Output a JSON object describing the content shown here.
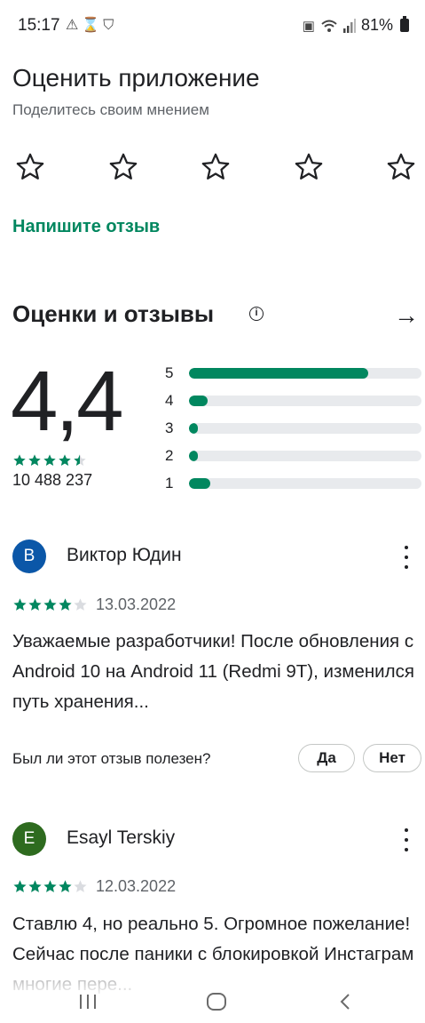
{
  "status_bar": {
    "time": "15:17",
    "battery": "81%",
    "left_icons": [
      "warning-icon",
      "hourglass-icon",
      "shield-icon"
    ],
    "right_icons": [
      "vibrate-icon",
      "wifi-icon",
      "signal-icon",
      "battery-icon"
    ]
  },
  "rate": {
    "title": "Оценить приложение",
    "subtitle": "Поделитесь своим мнением",
    "star_count": 5,
    "write_review": "Напишите отзыв"
  },
  "ratings": {
    "title": "Оценки и отзывы",
    "score": "4,4",
    "score_stars": 4.5,
    "count": "10 488 237",
    "distribution": [
      {
        "label": "5",
        "fraction": 0.77
      },
      {
        "label": "4",
        "fraction": 0.08
      },
      {
        "label": "3",
        "fraction": 0.04
      },
      {
        "label": "2",
        "fraction": 0.04
      },
      {
        "label": "1",
        "fraction": 0.09
      }
    ]
  },
  "reviews": [
    {
      "initial": "B",
      "avatar_color": "#0b57a8",
      "name": "Виктор Юдин",
      "stars": 4,
      "date": "13.03.2022",
      "text": "Уважаемые разработчики! После обновления с Android 10 на Android 11 (Redmi 9T), изменился путь хранения...",
      "helpful_question": "Был ли этот отзыв полезен?",
      "yes": "Да",
      "no": "Нет"
    },
    {
      "initial": "E",
      "avatar_color": "#2e6b1f",
      "name": "Esayl Terskiy",
      "stars": 4,
      "date": "12.03.2022",
      "text": "Ставлю 4, но реально 5. Огромное пожелание! Сейчас после паники с блокировкой Инстаграм многие пере..."
    }
  ],
  "colors": {
    "accent": "#01875f",
    "track": "#e8eaed",
    "star_empty": "#dadce0"
  },
  "nav": [
    "recent-apps-icon",
    "home-icon",
    "back-icon"
  ]
}
